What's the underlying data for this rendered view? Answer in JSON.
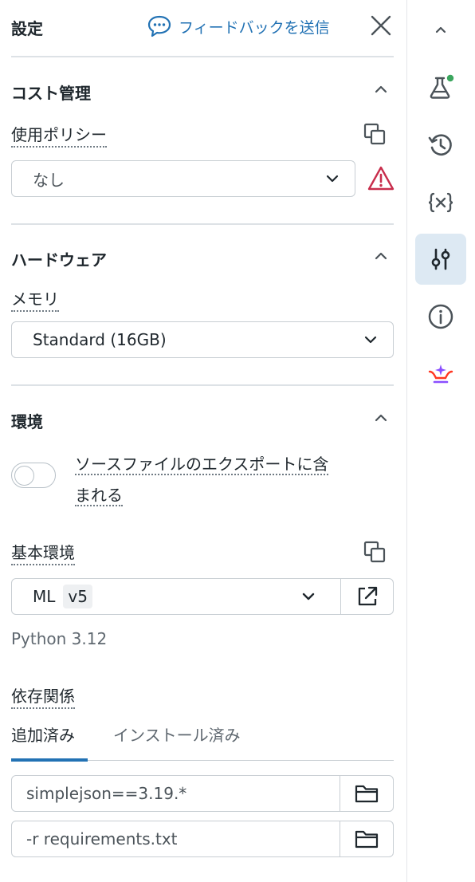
{
  "header": {
    "title": "設定",
    "feedback_label": "フィードバックを送信"
  },
  "cost": {
    "title": "コスト管理",
    "policy_label": "使用ポリシー",
    "policy_value": "なし"
  },
  "hardware": {
    "title": "ハードウェア",
    "memory_label": "メモリ",
    "memory_value": "Standard (16GB)"
  },
  "environment": {
    "title": "環境",
    "toggle_line1": "ソースファイルのエクスポートに含",
    "toggle_line2": "まれる",
    "toggle_on": false,
    "base_label": "基本環境",
    "base_value": "ML",
    "base_version": "v5",
    "python_version": "Python 3.12",
    "deps_label": "依存関係",
    "tabs": [
      "追加済み",
      "インストール済み"
    ],
    "dependencies": [
      "simplejson==3.19.*",
      "-r requirements.txt"
    ]
  },
  "rail": {
    "items": [
      "chevron-up-icon",
      "flask-icon",
      "history-icon",
      "variables-icon",
      "sliders-icon",
      "info-icon",
      "assistant-icon"
    ],
    "active": "sliders-icon"
  },
  "colors": {
    "accent": "#2272b4",
    "warning": "#c82d4c",
    "status_dot": "#3ba65e",
    "assistant": "#8a4fff"
  }
}
